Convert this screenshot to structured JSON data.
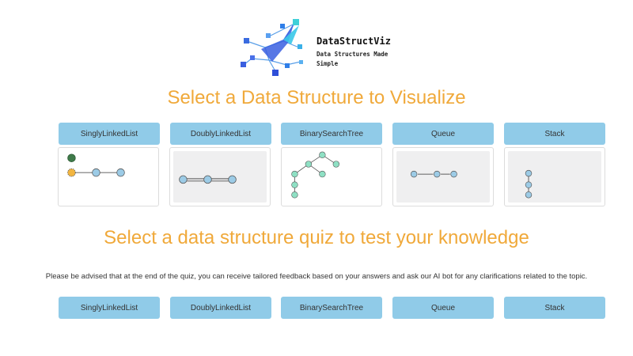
{
  "brand": {
    "name": "DataStructViz",
    "tagline": "Data Structures Made Simple"
  },
  "visualize": {
    "heading": "Select a Data Structure to Visualize",
    "buttons": [
      "SinglyLinkedList",
      "DoublyLinkedList",
      "BinarySearchTree",
      "Queue",
      "Stack"
    ]
  },
  "quiz": {
    "heading": "Select a data structure quiz to test your knowledge",
    "notice": "Please be advised that at the end of the quiz, you can receive tailored feedback based on your answers and ask our AI bot for any clarifications related to the topic.",
    "buttons": [
      "SinglyLinkedList",
      "DoublyLinkedList",
      "BinarySearchTree",
      "Queue",
      "Stack"
    ]
  },
  "colors": {
    "accent": "#f0a93a",
    "button": "#90cbe8",
    "node_blue": "#9ccbe6",
    "node_green": "#8fe0c4",
    "node_orange": "#f2b540",
    "node_dark_green": "#3f7a4a"
  }
}
